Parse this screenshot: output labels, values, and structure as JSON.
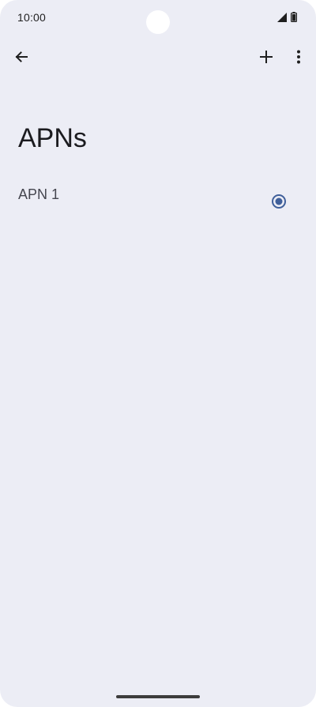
{
  "status_bar": {
    "time": "10:00",
    "icons": [
      "signal-icon",
      "battery-icon"
    ]
  },
  "toolbar": {
    "back_icon": "back-arrow-icon",
    "add_icon": "add-icon",
    "more_icon": "more-vert-icon"
  },
  "page": {
    "title": "APNs"
  },
  "apn_list": [
    {
      "label": "APN 1",
      "selected": true
    }
  ],
  "colors": {
    "background": "#ecedf5",
    "accent": "#3f5f9a",
    "text_primary": "#1b1b1f",
    "text_secondary": "#45464f"
  }
}
